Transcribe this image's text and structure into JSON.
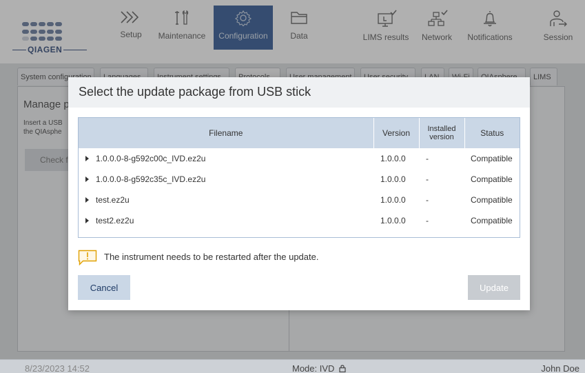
{
  "brand": {
    "logo_text": "QIAGEN"
  },
  "nav": {
    "items": [
      {
        "label": "Setup",
        "icon": "chevrons-right-icon"
      },
      {
        "label": "Maintenance",
        "icon": "tools-icon"
      },
      {
        "label": "Configuration",
        "icon": "gear-icon",
        "active": true
      },
      {
        "label": "Data",
        "icon": "folder-icon"
      },
      {
        "label": "LIMS results",
        "icon": "monitor-check-icon"
      },
      {
        "label": "Network",
        "icon": "network-check-icon"
      },
      {
        "label": "Notifications",
        "icon": "bell-icon"
      },
      {
        "label": "Session",
        "icon": "user-logout-icon"
      }
    ]
  },
  "tabs": [
    "System configuration",
    "Languages",
    "Instrument settings",
    "Protocols",
    "User management",
    "User security",
    "LAN",
    "Wi-Fi",
    "QIAsphere",
    "LIMS"
  ],
  "panel": {
    "title": "Manage p",
    "text_line1": "Insert a USB",
    "text_line2": "the QIAsphe",
    "button": "Check fo"
  },
  "dialog": {
    "title": "Select the update package from USB stick",
    "columns": {
      "filename": "Filename",
      "version": "Version",
      "installed_line1": "Installed",
      "installed_line2": "version",
      "status": "Status"
    },
    "rows": [
      {
        "filename": "1.0.0.0-8-g592c00c_IVD.ez2u",
        "version": "1.0.0.0",
        "installed": "-",
        "status": "Compatible"
      },
      {
        "filename": "1.0.0.0-8-g592c35c_IVD.ez2u",
        "version": "1.0.0.0",
        "installed": "-",
        "status": "Compatible"
      },
      {
        "filename": "test.ez2u",
        "version": "1.0.0.0",
        "installed": "-",
        "status": "Compatible"
      },
      {
        "filename": "test2.ez2u",
        "version": "1.0.0.0",
        "installed": "-",
        "status": "Compatible"
      }
    ],
    "warning": "The instrument needs to be restarted after the update.",
    "cancel_label": "Cancel",
    "update_label": "Update"
  },
  "status": {
    "datetime": "8/23/2023 14:52",
    "mode": "Mode: IVD",
    "user": "John Doe"
  },
  "colors": {
    "active_nav": "#1f4a8a",
    "header_row": "#cad7e6",
    "cancel_bg": "#cad7e6",
    "update_disabled_bg": "#c8ccd1"
  }
}
